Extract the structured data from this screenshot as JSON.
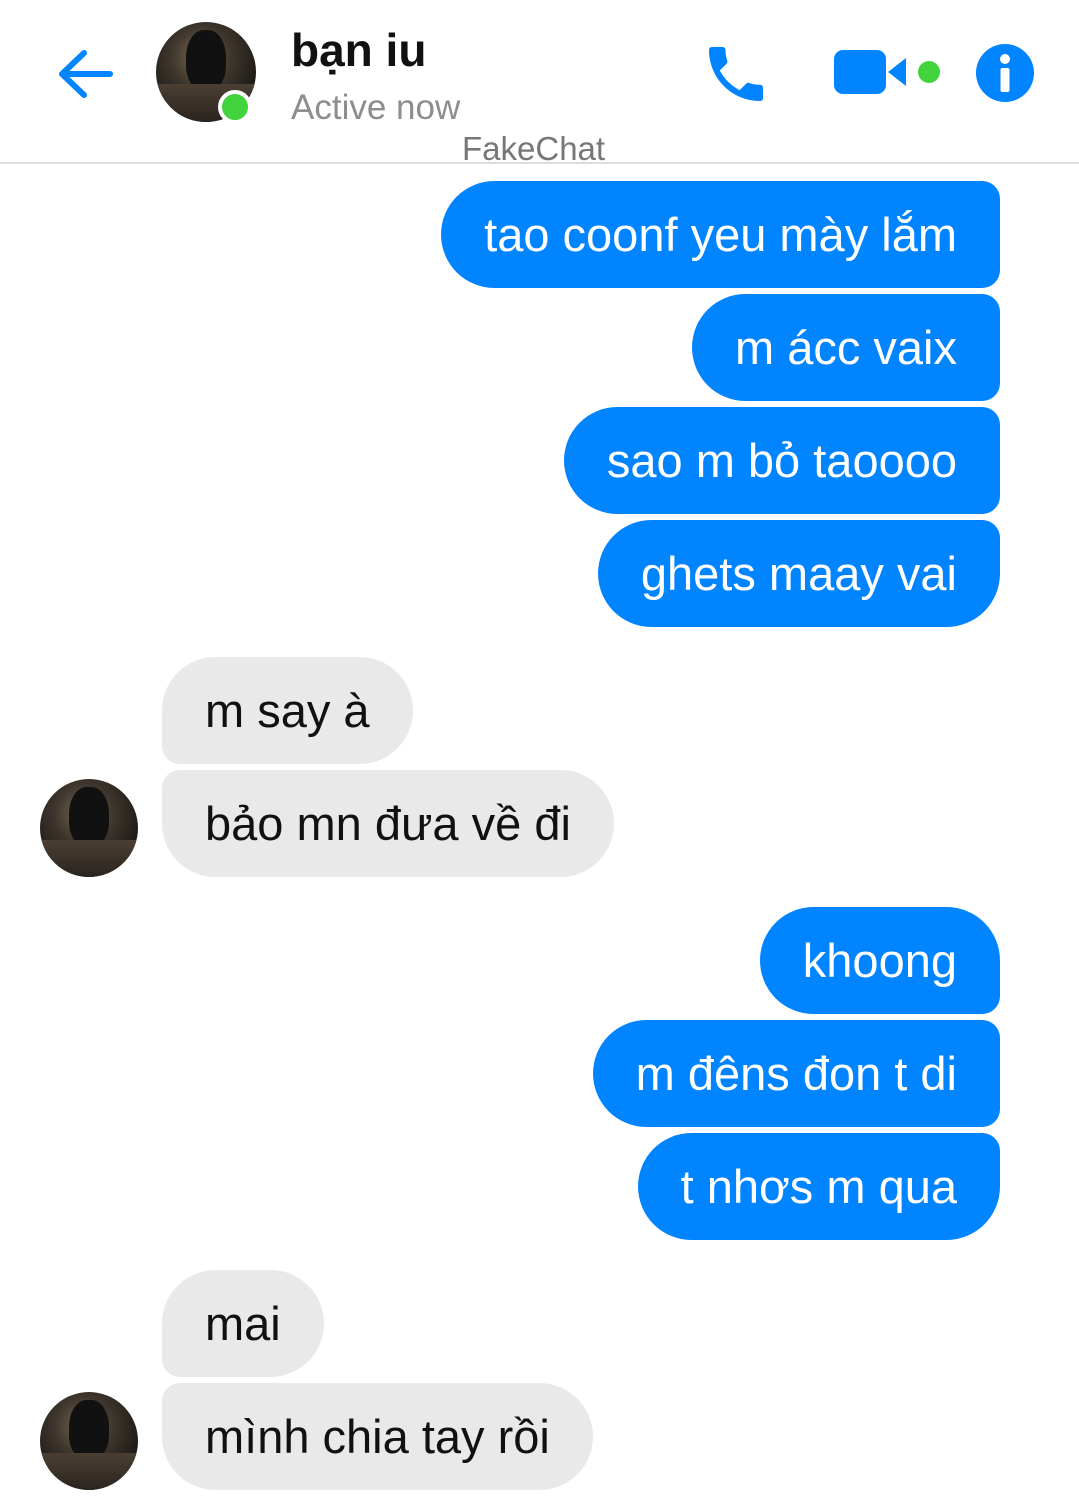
{
  "header": {
    "contact_name": "bạn iu",
    "status": "Active now",
    "watermark": "FakeChat"
  },
  "colors": {
    "accent": "#0084ff",
    "incoming_bubble": "#e9e9e9",
    "online": "#42d23b"
  },
  "icons": {
    "back": "arrow-left-icon",
    "call": "phone-icon",
    "video": "video-camera-icon",
    "info": "info-icon"
  },
  "messages": [
    {
      "from": "me",
      "text": "tao coonf yeu mày lắm"
    },
    {
      "from": "me",
      "text": "m ácc vaix"
    },
    {
      "from": "me",
      "text": "sao m bỏ taoooo"
    },
    {
      "from": "me",
      "text": "ghets maay vai"
    },
    {
      "from": "them",
      "text": "m say à"
    },
    {
      "from": "them",
      "text": "bảo mn đưa về đi"
    },
    {
      "from": "me",
      "text": "khoong"
    },
    {
      "from": "me",
      "text": "m đêns đon t di"
    },
    {
      "from": "me",
      "text": "t nhơs m qua"
    },
    {
      "from": "them",
      "text": "mai"
    },
    {
      "from": "them",
      "text": "mình chia tay rồi"
    }
  ]
}
